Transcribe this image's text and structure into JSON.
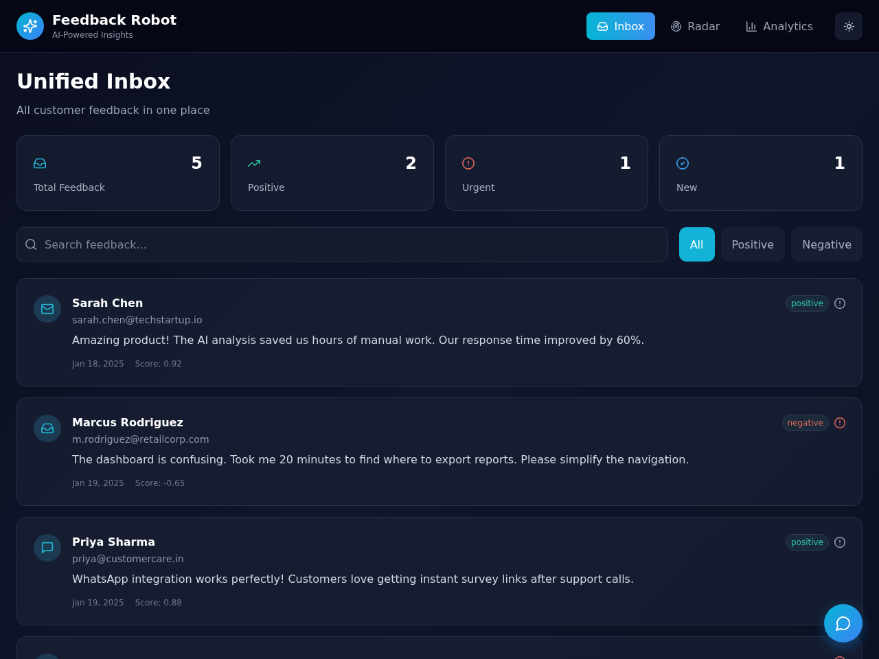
{
  "header": {
    "title": "Feedback Robot",
    "subtitle": "AI-Powered Insights",
    "nav": [
      {
        "label": "Inbox",
        "kind": "inbox",
        "selected": true
      },
      {
        "label": "Radar",
        "kind": "radar",
        "selected": false
      },
      {
        "label": "Analytics",
        "kind": "chart",
        "selected": false
      }
    ]
  },
  "page": {
    "title": "Unified Inbox",
    "subtitle": "All customer feedback in one place"
  },
  "stats": [
    {
      "label": "Total Feedback",
      "value": "5",
      "kind": "inbox",
      "color": "#22b8d6"
    },
    {
      "label": "Positive",
      "value": "2",
      "kind": "trend",
      "color": "#2bb596"
    },
    {
      "label": "Urgent",
      "value": "1",
      "kind": "alert",
      "color": "#e5685a"
    },
    {
      "label": "New",
      "value": "1",
      "kind": "check",
      "color": "#3aa0e8"
    }
  ],
  "search": {
    "placeholder": "Search feedback..."
  },
  "filters": [
    {
      "label": "All",
      "selected": true
    },
    {
      "label": "Positive",
      "selected": false
    },
    {
      "label": "Negative",
      "selected": false
    }
  ],
  "feedback": [
    {
      "name": "Sarah Chen",
      "email": "sarah.chen@techstartup.io",
      "message": "Amazing product! The AI analysis saved us hours of manual work. Our response time improved by 60%.",
      "date": "Jan 18, 2025",
      "score": "Score: 0.92",
      "kind": "mail",
      "badge": {
        "text": "positive",
        "color": "#2dc4a8"
      },
      "urgent": false
    },
    {
      "name": "Marcus Rodriguez",
      "email": "m.rodriguez@retailcorp.com",
      "message": "The dashboard is confusing. Took me 20 minutes to find where to export reports. Please simplify the navigation.",
      "date": "Jan 19, 2025",
      "score": "Score: -0.65",
      "kind": "inbox",
      "badge": {
        "text": "negative",
        "color": "#e5685a"
      },
      "urgent": true
    },
    {
      "name": "Priya Sharma",
      "email": "priya@customercare.in",
      "message": "WhatsApp integration works perfectly! Customers love getting instant survey links after support calls.",
      "date": "Jan 19, 2025",
      "score": "Score: 0.88",
      "kind": "message",
      "badge": {
        "text": "positive",
        "color": "#2dc4a8"
      },
      "urgent": false
    },
    {
      "urgent": true
    }
  ]
}
